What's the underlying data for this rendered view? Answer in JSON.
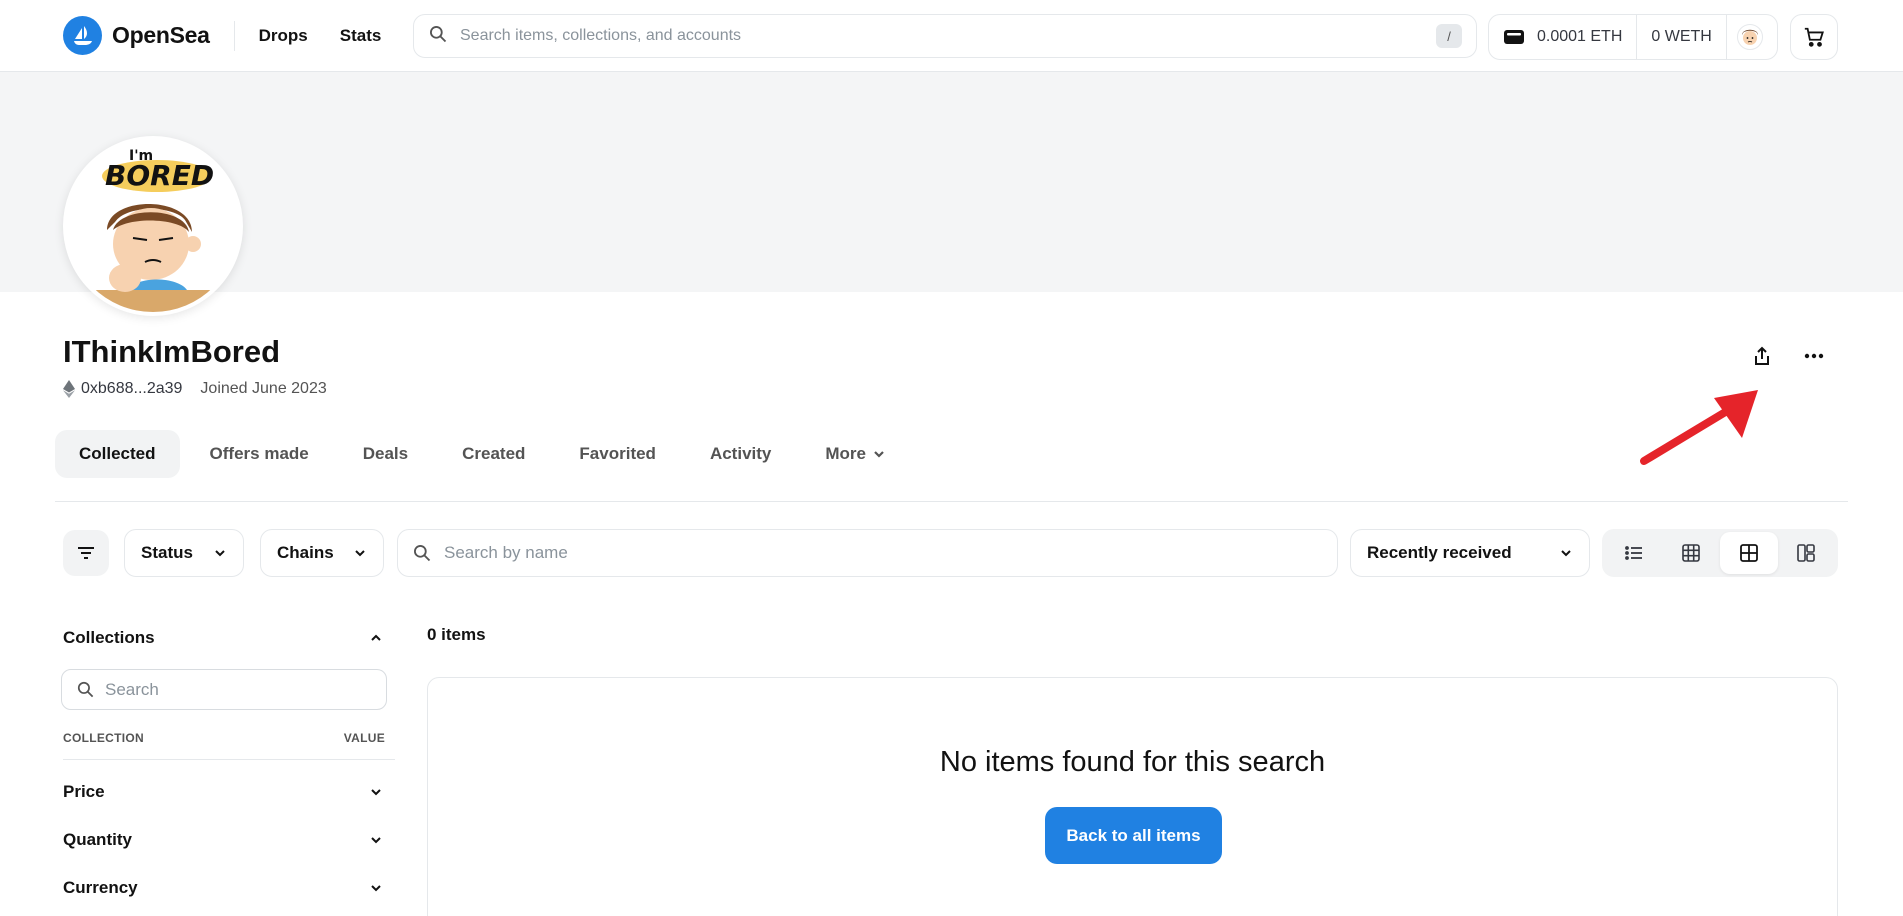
{
  "header": {
    "logo_text": "OpenSea",
    "nav": [
      "Drops",
      "Stats"
    ],
    "search_placeholder": "Search items, collections, and accounts",
    "search_shortcut": "/",
    "wallet": {
      "eth": "0.0001 ETH",
      "weth": "0 WETH"
    }
  },
  "profile": {
    "name": "IThinkImBored",
    "address": "0xb688...2a39",
    "joined": "Joined June 2023",
    "avatar_text": {
      "top": "I'm",
      "main": "BORED"
    }
  },
  "tabs": [
    {
      "label": "Collected",
      "active": true
    },
    {
      "label": "Offers made"
    },
    {
      "label": "Deals"
    },
    {
      "label": "Created"
    },
    {
      "label": "Favorited"
    },
    {
      "label": "Activity"
    },
    {
      "label": "More"
    }
  ],
  "filters": {
    "status": "Status",
    "chains": "Chains",
    "search_placeholder": "Search by name",
    "sort": "Recently received"
  },
  "sidebar": {
    "collections_title": "Collections",
    "search_placeholder": "Search",
    "col_collection": "COLLECTION",
    "col_value": "VALUE",
    "sections": [
      "Price",
      "Quantity",
      "Currency"
    ]
  },
  "content": {
    "items_count": "0 items",
    "empty_message": "No items found for this search",
    "back_button": "Back to all items"
  },
  "colors": {
    "accent": "#2081e2",
    "annotation": "#e5242a"
  }
}
